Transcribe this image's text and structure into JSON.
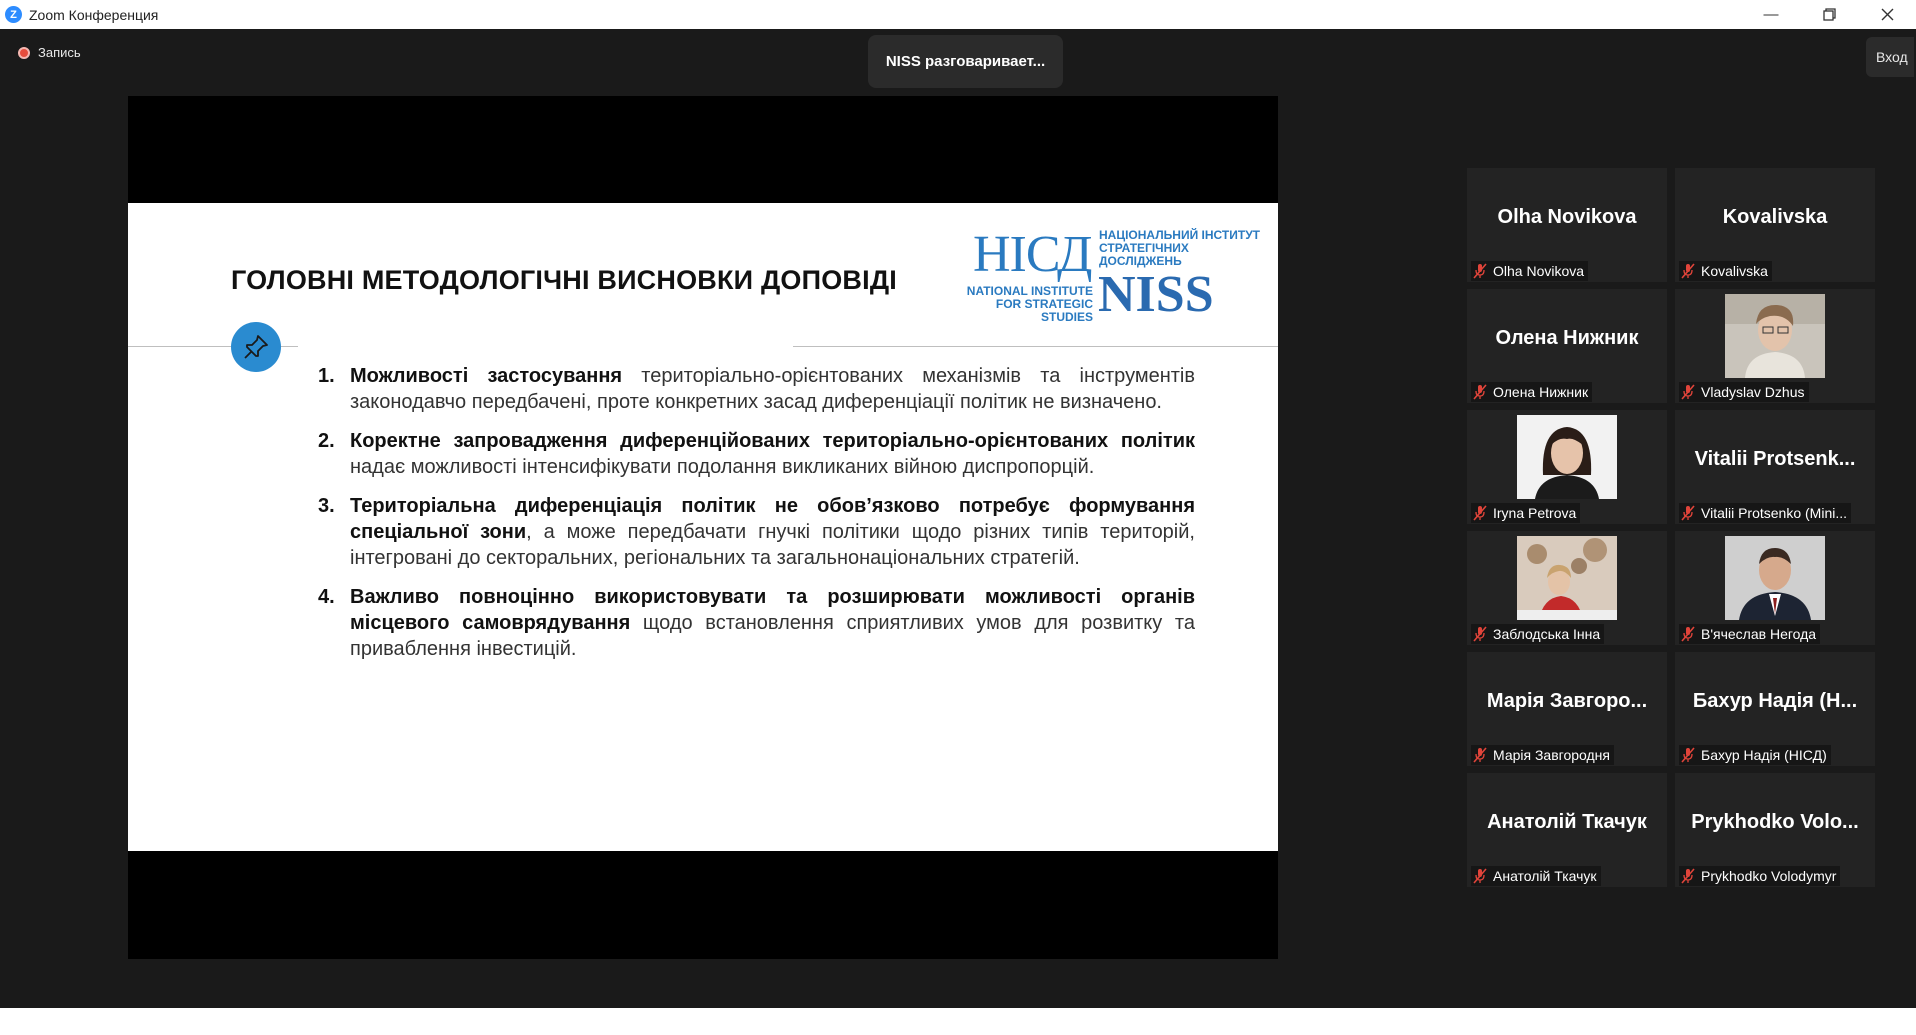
{
  "window": {
    "title": "Zoom Конференция"
  },
  "toolbar": {
    "record_label": "Запись",
    "active_speaker": "NISS разговаривает...",
    "enter_label": "Вход"
  },
  "slide": {
    "title": "ГОЛОВНІ МЕТОДОЛОГІЧНІ ВИСНОВКИ ДОПОВІДІ",
    "logo": {
      "hisd": "НІСД",
      "ua_line1": "НАЦІОНАЛЬНИЙ ІНСТИТУТ",
      "ua_line2": "СТРАТЕГІЧНИХ ДОСЛІДЖЕНЬ",
      "en_line1": "NATIONAL INSTITUTE",
      "en_line2": "FOR STRATEGIC STUDIES",
      "niss": "NISS"
    },
    "points": [
      {
        "num": "1.",
        "bold": "Можливості застосування",
        "text": " територіально-орієнтованих механізмів та інструментів законодавчо передбачені, проте конкретних засад диференціації політик не визначено."
      },
      {
        "num": "2.",
        "bold": "Коректне запровадження диференційованих територіально-орієнтованих політик",
        "text": " надає можливості інтенсифікувати подолання викликаних війною диспропорцій."
      },
      {
        "num": "3.",
        "bold": "Територіальна диференціація політик не обов’язково потребує формування спеціальної зони",
        "text": ", а може передбачати гнучкі політики щодо різних типів територій, інтегровані до секторальних, регіональних та загальнонаціональних стратегій."
      },
      {
        "num": "4.",
        "bold": "Важливо повноцінно використовувати та розширювати можливості органів місцевого самоврядування",
        "text": " щодо встановлення сприятливих умов для розвитку та приваблення інвестицій."
      }
    ]
  },
  "participants": [
    {
      "big": "Olha Novikova",
      "label": "Olha Novikova"
    },
    {
      "big": "Kovalivska",
      "label": "Kovalivska"
    },
    {
      "big": "Олена Нижник",
      "label": "Олена Нижник"
    },
    {
      "big": "",
      "label": "Vladyslav Dzhus"
    },
    {
      "big": "",
      "label": "Iryna Petrova"
    },
    {
      "big": "Vitalii  Protsenk...",
      "label": "Vitalii Protsenko (Mini..."
    },
    {
      "big": "",
      "label": "Заблодська Інна"
    },
    {
      "big": "",
      "label": "В'ячеслав Негода"
    },
    {
      "big": "Марія Завгоро...",
      "label": "Марія Завгородня"
    },
    {
      "big": "Бахур Надія (Н...",
      "label": "Бахур Надія (НІСД)"
    },
    {
      "big": "Анатолій Ткачук",
      "label": "Анатолій Ткачук"
    },
    {
      "big": "Prykhodko Volo...",
      "label": "Prykhodko Volodymyr"
    }
  ],
  "colors": {
    "accent": "#2d8cff",
    "muted_mic": "#e0443a",
    "niss_blue": "#2a7ac0"
  }
}
